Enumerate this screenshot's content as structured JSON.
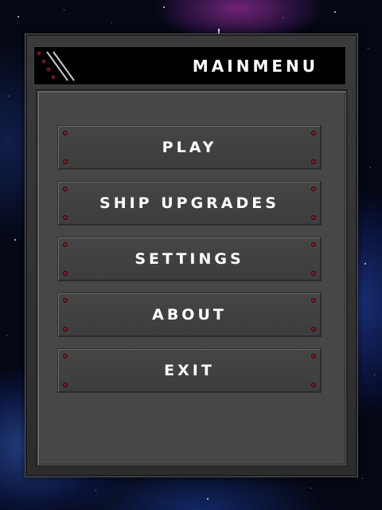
{
  "menu": {
    "title": "MAINMENU",
    "buttons": [
      {
        "label": "PLAY"
      },
      {
        "label": "SHIP UPGRADES"
      },
      {
        "label": "SETTINGS"
      },
      {
        "label": "ABOUT"
      },
      {
        "label": "EXIT"
      }
    ]
  },
  "colors": {
    "frame": "#2e2e2e",
    "panel": "#474747",
    "button": "#414141",
    "rivet": "#7a1f2a",
    "text": "#ffffff"
  }
}
